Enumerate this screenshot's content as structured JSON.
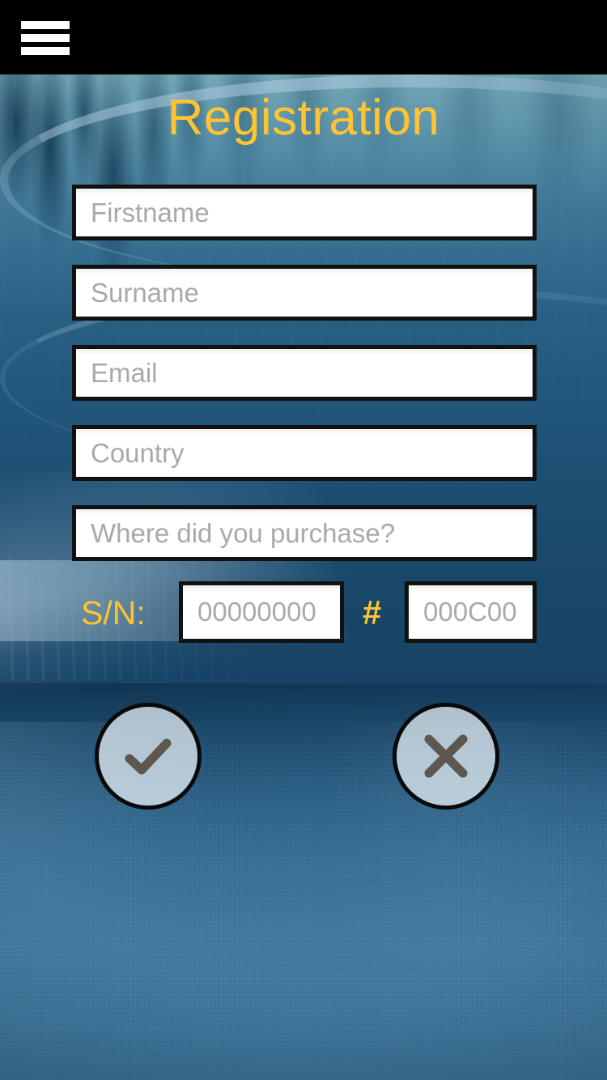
{
  "appbar": {
    "menu_icon": "hamburger-menu-icon"
  },
  "page": {
    "title": "Registration",
    "title_color": "#ffc430"
  },
  "form": {
    "fields": [
      {
        "name": "firstname",
        "placeholder": "Firstname",
        "value": ""
      },
      {
        "name": "surname",
        "placeholder": "Surname",
        "value": ""
      },
      {
        "name": "email",
        "placeholder": "Email",
        "value": ""
      },
      {
        "name": "country",
        "placeholder": "Country",
        "value": ""
      },
      {
        "name": "purchase_location",
        "placeholder": "Where did you purchase?",
        "value": ""
      }
    ]
  },
  "serial": {
    "label": "S/N:",
    "separator": "#",
    "serial_placeholder": "00000000",
    "serial_value": "",
    "code_placeholder": "000C00",
    "code_value": ""
  },
  "actions": {
    "confirm_icon": "check-icon",
    "cancel_icon": "close-icon",
    "icon_color": "#5d574f"
  },
  "theme": {
    "appbar_background": "#000000",
    "accent": "#ffc430",
    "field_background": "#ffffff",
    "field_border": "#111111",
    "placeholder_color": "#a9a9a9",
    "background_tint": "#1f5074"
  }
}
